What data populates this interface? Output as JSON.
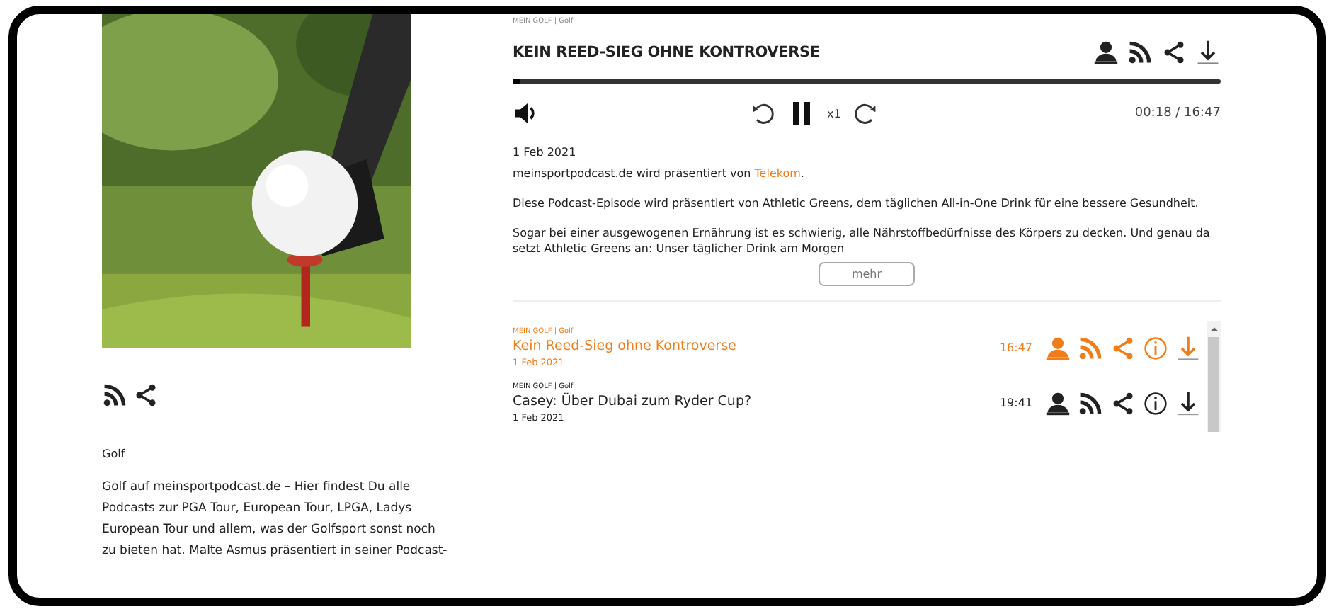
{
  "podcast": {
    "category": "Golf",
    "description": "Golf auf meinsportpodcast.de – Hier findest Du alle Podcasts zur PGA Tour, European Tour, LPGA, Ladys European Tour und allem, was der Golfsport sonst noch zu bieten hat. Malte Asmus präsentiert in seiner Podcast-"
  },
  "player": {
    "category": "MEIN GOLF | Golf",
    "title": "KEIN REED-SIEG OHNE KONTROVERSE",
    "level": 0.01,
    "speed": "x1",
    "time": "00:18 / 16:47",
    "playing": true
  },
  "episode_details": {
    "date": "1 Feb 2021",
    "paragraphs": [
      "meinsportpodcast.de wird präsentiert von **Telekom**.",
      "Diese Podcast-Episode wird präsentiert von Athletic Greens, dem täglichen All-in-One Drink für eine bessere Gesundheit.",
      "Sogar bei einer ausgewogenen Ernährung ist es schwierig, alle Nährstoffbedürfnisse des Körpers zu decken. Und genau da setzt Athletic Greens an: Unser täglicher Drink am Morgen"
    ],
    "more_button": "mehr"
  },
  "episodes": [
    {
      "category": "MEIN GOLF | Golf",
      "title": "Kein Reed-Sieg ohne Kontroverse",
      "date": "1 Feb 2021",
      "duration": "16:47",
      "selected": true
    },
    {
      "category": "MEIN GOLF | Golf",
      "title": "Casey: Über Dubai zum Ryder Cup?",
      "date": "1 Feb 2021",
      "duration": "19:41",
      "selected": false
    }
  ]
}
